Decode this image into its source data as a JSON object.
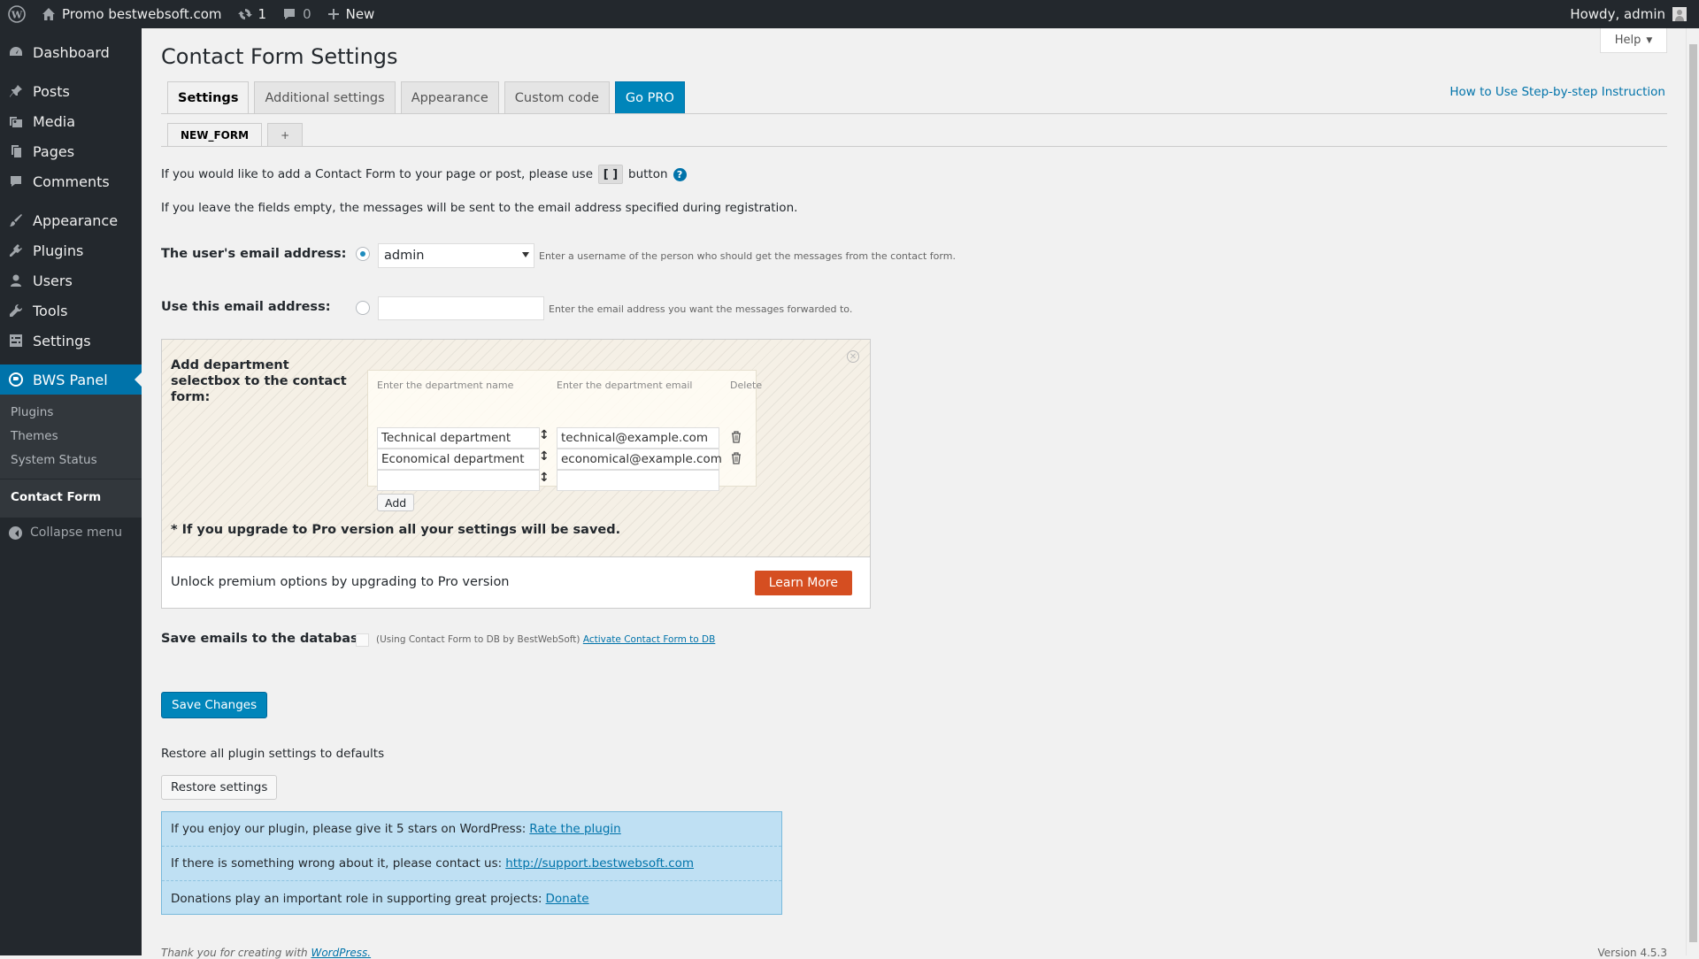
{
  "adminbar": {
    "site_name": "Promo bestwebsoft.com",
    "updates_count": "1",
    "comments_count": "0",
    "new_label": "New",
    "howdy": "Howdy, admin"
  },
  "sidebar": {
    "items": [
      {
        "label": "Dashboard"
      },
      {
        "label": "Posts"
      },
      {
        "label": "Media"
      },
      {
        "label": "Pages"
      },
      {
        "label": "Comments"
      },
      {
        "label": "Appearance"
      },
      {
        "label": "Plugins"
      },
      {
        "label": "Users"
      },
      {
        "label": "Tools"
      },
      {
        "label": "Settings"
      },
      {
        "label": "BWS Panel"
      }
    ],
    "submenu": [
      "Plugins",
      "Themes",
      "System Status"
    ],
    "contact_form": "Contact Form",
    "collapse": "Collapse menu"
  },
  "help_label": "Help",
  "page_title": "Contact Form Settings",
  "tabs": [
    "Settings",
    "Additional settings",
    "Appearance",
    "Custom code",
    "Go PRO"
  ],
  "howto_link": "How to Use Step-by-step Instruction",
  "subtabs": [
    "NEW_FORM",
    "+"
  ],
  "intro": {
    "before": "If you would like to add a Contact Form to your page or post, please use",
    "after": "button",
    "help_q": "?"
  },
  "empty_note": "If you leave the fields empty, the messages will be sent to the email address specified during registration.",
  "user_email": {
    "label": "The user's email address:",
    "selected": "admin",
    "hint": "Enter a username of the person who should get the messages from the contact form."
  },
  "use_email": {
    "label": "Use this email address:",
    "value": "",
    "hint": "Enter the email address you want the messages forwarded to."
  },
  "pro_box": {
    "title": "Add department selectbox to the contact form:",
    "col_name": "Enter the department name",
    "col_email": "Enter the department email",
    "col_delete": "Delete",
    "rows": [
      {
        "name": "Technical department",
        "email": "technical@example.com"
      },
      {
        "name": "Economical department",
        "email": "economical@example.com"
      },
      {
        "name": "",
        "email": ""
      }
    ],
    "add_label": "Add",
    "note": "* If you upgrade to Pro version all your settings will be saved.",
    "unlock_text": "Unlock premium options by upgrading to Pro version",
    "learn_more": "Learn More"
  },
  "save_db": {
    "label": "Save emails to the database",
    "note": "(Using Contact Form to DB by BestWebSoft)",
    "link": "Activate Contact Form to DB"
  },
  "save_button": "Save Changes",
  "restore_text": "Restore all plugin settings to defaults",
  "restore_button": "Restore settings",
  "info": {
    "rate_text": "If you enjoy our plugin, please give it 5 stars on WordPress:",
    "rate_link": "Rate the plugin",
    "contact_text": "If there is something wrong about it, please contact us:",
    "contact_link": "http://support.bestwebsoft.com",
    "donate_text": "Donations play an important role in supporting great projects:",
    "donate_link": "Donate"
  },
  "footer": {
    "thanks": "Thank you for creating with",
    "wp_link": "WordPress.",
    "version": "Version 4.5.3"
  }
}
